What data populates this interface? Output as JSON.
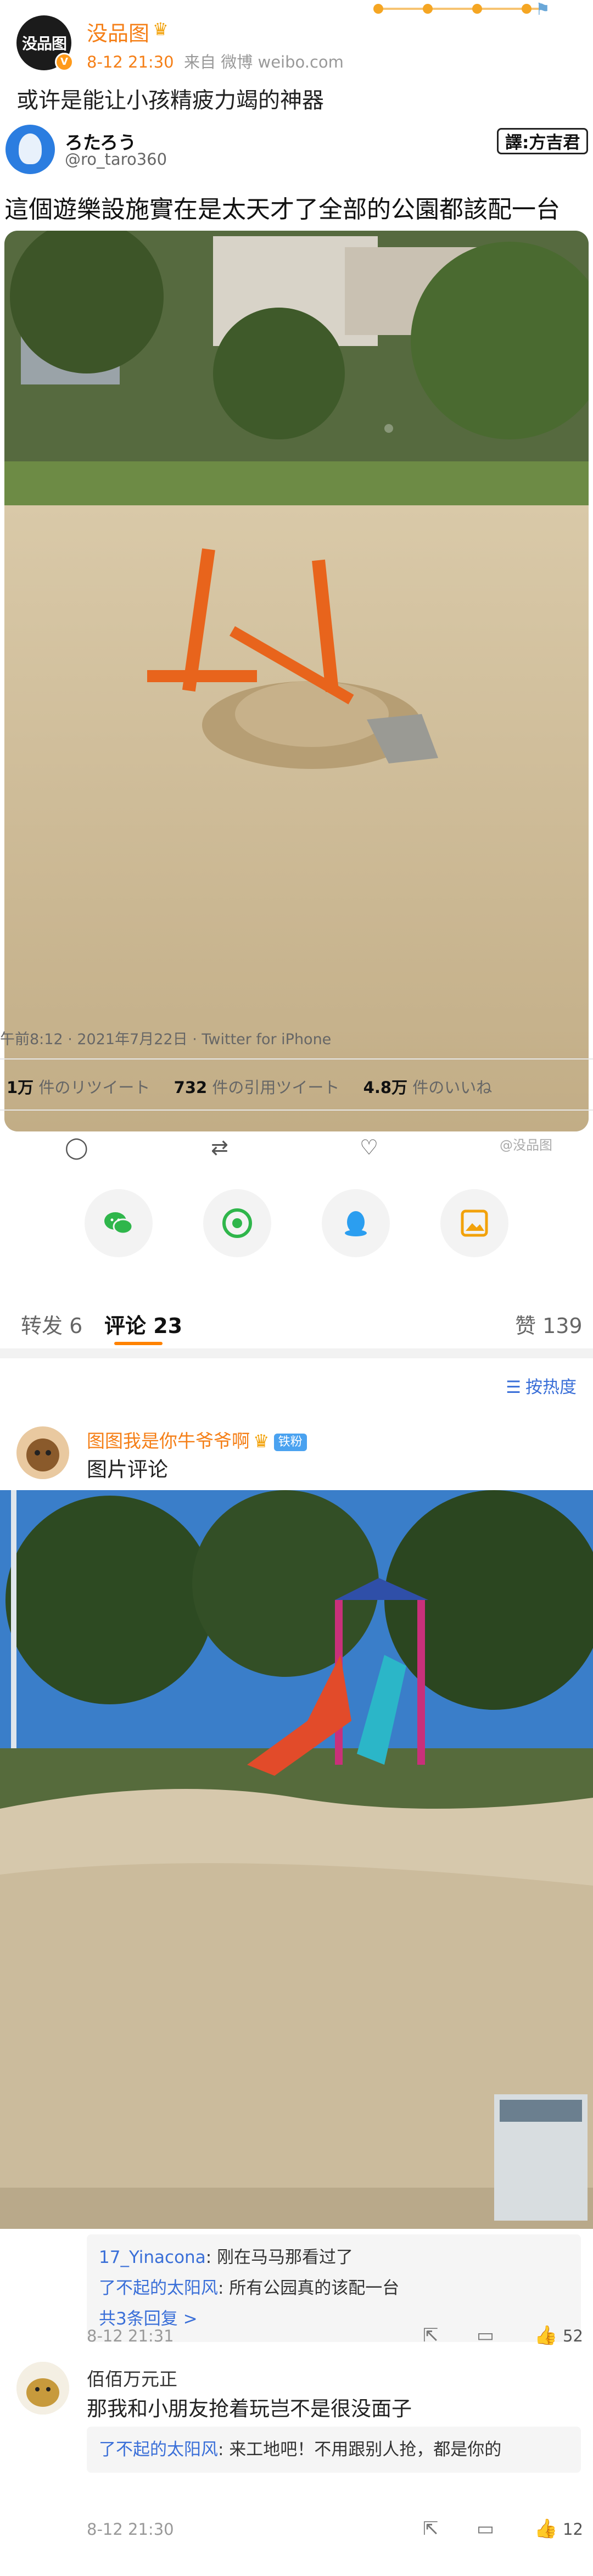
{
  "post": {
    "author": "没品图",
    "avatar_text": "没品图",
    "time": "8-12 21:30",
    "source": "来自 微博 weibo.com",
    "text": "或许是能让小孩精疲力竭的神器",
    "crown_icon": "crown-icon"
  },
  "tweet": {
    "name": "ろたろう",
    "handle": "@ro_taro360",
    "translator_label": "譯:方吉君",
    "text": "這個遊樂設施實在是太天才了全部的公園都該配一台",
    "date": "午前8:12 · 2021年7月22日 · Twitter for iPhone",
    "stats": [
      {
        "num": "1万",
        "label": "件のリツイート"
      },
      {
        "num": "732",
        "label": "件の引用ツイート"
      },
      {
        "num": "4.8万",
        "label": "件のいいね"
      }
    ],
    "watermark": "@没品图"
  },
  "tabs": {
    "repost": "转发 6",
    "comments": "评论 23",
    "likes": "赞 139"
  },
  "sort": {
    "label": "按热度"
  },
  "comment1": {
    "name": "图图我是你牛爷爷啊",
    "badge": "铁粉",
    "text": "图片评论",
    "replies": [
      {
        "user": "17_Yinacona",
        "text": ": 刚在马马那看过了"
      },
      {
        "user": "了不起的太阳风",
        "text": ": 所有公园真的该配一台"
      }
    ],
    "more": "共3条回复 >",
    "time": "8-12 21:31",
    "likes": "52"
  },
  "comment2": {
    "name": "佰佰万元正",
    "text": "那我和小朋友抢着玩岂不是很没面子",
    "replies": [
      {
        "user": "了不起的太阳风",
        "text": ": 来工地吧！不用跟别人抢，都是你的"
      }
    ],
    "time": "8-12 21:30",
    "likes": "12"
  },
  "colors": {
    "accent_orange": "#f57f17",
    "link_blue": "#3a6fd8",
    "tab_underline": "#ff8200"
  }
}
